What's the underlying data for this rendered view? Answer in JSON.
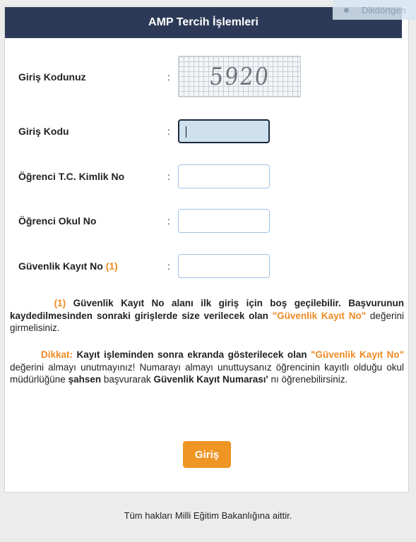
{
  "header": {
    "title": "AMP Tercih İşlemleri"
  },
  "overlay": {
    "shape_label": "Dikdörtgen"
  },
  "form": {
    "captcha": {
      "label": "Giriş Kodunuz",
      "colon": ":",
      "code": "5920"
    },
    "code_input": {
      "label": "Giriş Kodu",
      "colon": ":",
      "value": ""
    },
    "tc_input": {
      "label": "Öğrenci T.C. Kimlik No",
      "colon": ":",
      "value": ""
    },
    "school_input": {
      "label": "Öğrenci Okul No",
      "colon": ":",
      "value": ""
    },
    "security_input": {
      "label": "Güvenlik Kayıt No",
      "note_ref": "(1)",
      "colon": ":",
      "value": ""
    }
  },
  "notes": {
    "note1": {
      "marker": "(1)",
      "bold_text": "Güvenlik Kayıt No alanı ilk giriş için boş geçilebilir. Başvurunun kaydedilmesinden sonraki  girişlerde size verilecek olan",
      "highlight": "\"Güvenlik Kayıt No\"",
      "tail": "değerini girmelisiniz."
    },
    "note2": {
      "prefix": "Dikkat:",
      "bold_text": "Kayıt işleminden sonra ekranda gösterilecek olan",
      "highlight": "\"Güvenlik Kayıt No\"",
      "text1": "değerini almayı unutmayınız!  Numarayı almayı unuttuysanız öğrencinin kayıtlı olduğu okul müdürlüğüne",
      "bold2": "şahsen",
      "text2": "başvurarak",
      "bold3": "Güvenlik Kayıt Numarası'",
      "text3": "nı öğrenebilirsiniz."
    }
  },
  "actions": {
    "submit_label": "Giriş"
  },
  "footer": {
    "text": "Tüm hakları Milli Eğitim Bakanlığına aittir."
  },
  "colors": {
    "header_bg": "#2d3a57",
    "accent_orange": "#ef9524",
    "input_border": "#9ec3e6"
  }
}
